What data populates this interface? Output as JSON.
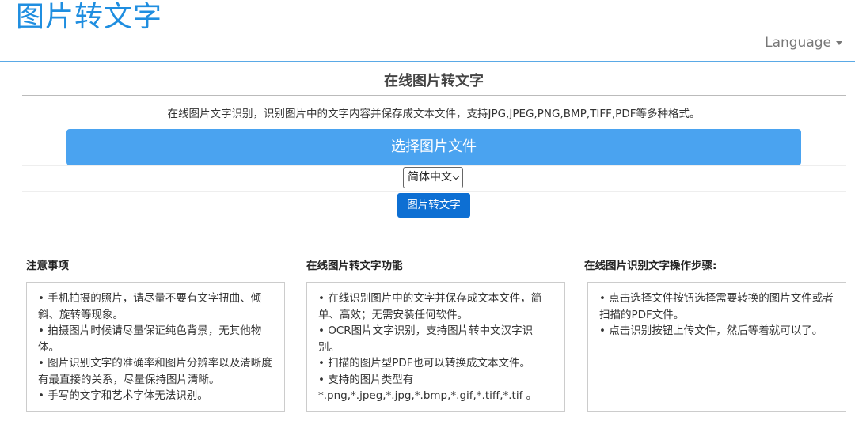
{
  "header": {
    "logo": "图片转文字",
    "language": "Language"
  },
  "main": {
    "title": "在线图片转文字",
    "description": "在线图片文字识别，识别图片中的文字内容并保存成文本文件，支持JPG,JPEG,PNG,BMP,TIFF,PDF等多种格式。",
    "choose_button": "选择图片文件",
    "language_select": "简体中文",
    "convert_button": "图片转文字"
  },
  "sections": [
    {
      "title": "注意事项",
      "items": [
        "• 手机拍摄的照片，请尽量不要有文字扭曲、倾斜、旋转等现象。",
        "• 拍摄图片时候请尽量保证纯色背景，无其他物体。",
        "• 图片识别文字的准确率和图片分辨率以及清晰度有最直接的关系，尽量保持图片清晰。",
        "• 手写的文字和艺术字体无法识别。"
      ]
    },
    {
      "title": "在线图片转文字功能",
      "items": [
        "• 在线识别图片中的文字并保存成文本文件，简单、高效；无需安装任何软件。",
        "• OCR图片文字识别，支持图片转中文汉字识别。",
        "• 扫描的图片型PDF也可以转换成文本文件。",
        "• 支持的图片类型有 *.png,*.jpeg,*.jpg,*.bmp,*.gif,*.tiff,*.tif 。"
      ]
    },
    {
      "title": "在线图片识别文字操作步骤:",
      "items": [
        "• 点击选择文件按钮选择需要转换的图片文件或者扫描的PDF文件。",
        "• 点击识别按钮上传文件，然后等着就可以了。"
      ]
    }
  ]
}
